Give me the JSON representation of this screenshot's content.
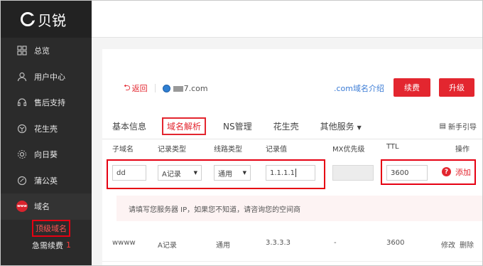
{
  "sidebar": {
    "logo_text": "贝锐",
    "items": [
      {
        "label": "总览",
        "icon": "grid-icon"
      },
      {
        "label": "用户中心",
        "icon": "user-icon"
      },
      {
        "label": "售后支持",
        "icon": "headset-icon"
      },
      {
        "label": "花生壳",
        "icon": "peanut-icon"
      },
      {
        "label": "向日葵",
        "icon": "sunflower-icon"
      },
      {
        "label": "蒲公英",
        "icon": "dandelion-icon"
      },
      {
        "label": "域名",
        "icon": "www-icon",
        "badge": "www"
      }
    ],
    "sub_items": [
      {
        "label": "顶级域名"
      },
      {
        "label": "急需续费",
        "count": "1"
      }
    ]
  },
  "domain_bar": {
    "back_label": "返回",
    "domain_masked_suffix": "7.com",
    "intro_link": ".com域名介绍",
    "renew_button": "续费",
    "upgrade_button": "升级"
  },
  "tabs": [
    {
      "label": "基本信息"
    },
    {
      "label": "域名解析",
      "active": true
    },
    {
      "label": "NS管理"
    },
    {
      "label": "花生壳"
    },
    {
      "label": "其他服务"
    }
  ],
  "guide_label": "新手引导",
  "table": {
    "headers": [
      "子域名",
      "记录类型",
      "线路类型",
      "记录值",
      "MX优先级",
      "TTL",
      "操作"
    ],
    "edit_row": {
      "subdomain": "dd",
      "record_type": "A记录",
      "line_type": "通用",
      "record_value": "1.1.1.1",
      "mx_priority": "",
      "ttl": "3600",
      "add_label": "添加",
      "help_icon": "?"
    },
    "hint": "请填写您服务器 IP，如果您不知道，请咨询您的空间商",
    "rows": [
      {
        "subdomain": "wwww",
        "record_type": "A记录",
        "line_type": "通用",
        "record_value": "3.3.3.3",
        "mx_priority": "-",
        "ttl": "3600",
        "edit_label": "修改",
        "delete_label": "删除"
      }
    ]
  },
  "colors": {
    "accent": "#e3262f",
    "sidebar_bg": "#2b2b2b",
    "link_blue": "#3a7bd5"
  }
}
